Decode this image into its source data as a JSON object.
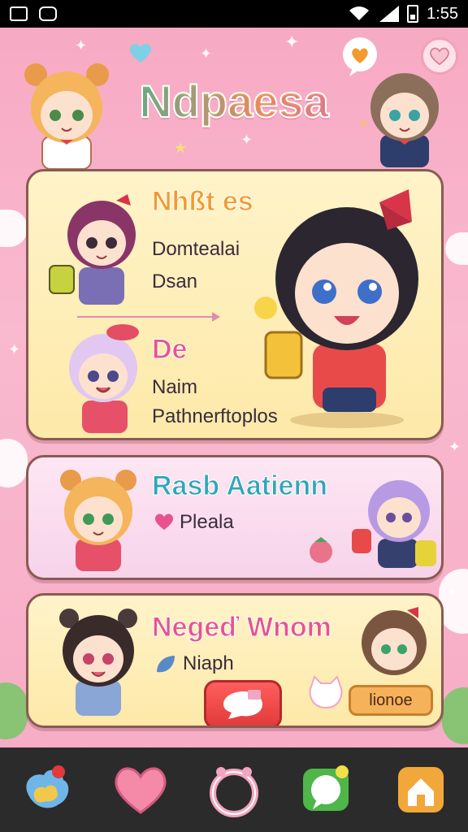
{
  "status_bar": {
    "time": "1:55"
  },
  "app": {
    "title": "Ndpaesa"
  },
  "cards": [
    {
      "heading": "Nhßt es",
      "line1": "Domtealai",
      "line2": "Dsan",
      "subheading": "De",
      "line3": "Naim",
      "line4": "Pathnerftoplos"
    },
    {
      "heading": "Rasb Aatienn",
      "line1": "Pleala"
    },
    {
      "heading": "Negeď Wnom",
      "line1": "Niaph",
      "pill_label": "lionoe"
    }
  ],
  "colors": {
    "accent_pink": "#e8538f",
    "accent_orange": "#f29a2e",
    "accent_green": "#3fbf8a",
    "accent_teal": "#2ea7b8"
  },
  "icons": [
    "heart-icon",
    "bubble-gum-icon",
    "ring-icon",
    "chat-icon",
    "home-icon"
  ]
}
